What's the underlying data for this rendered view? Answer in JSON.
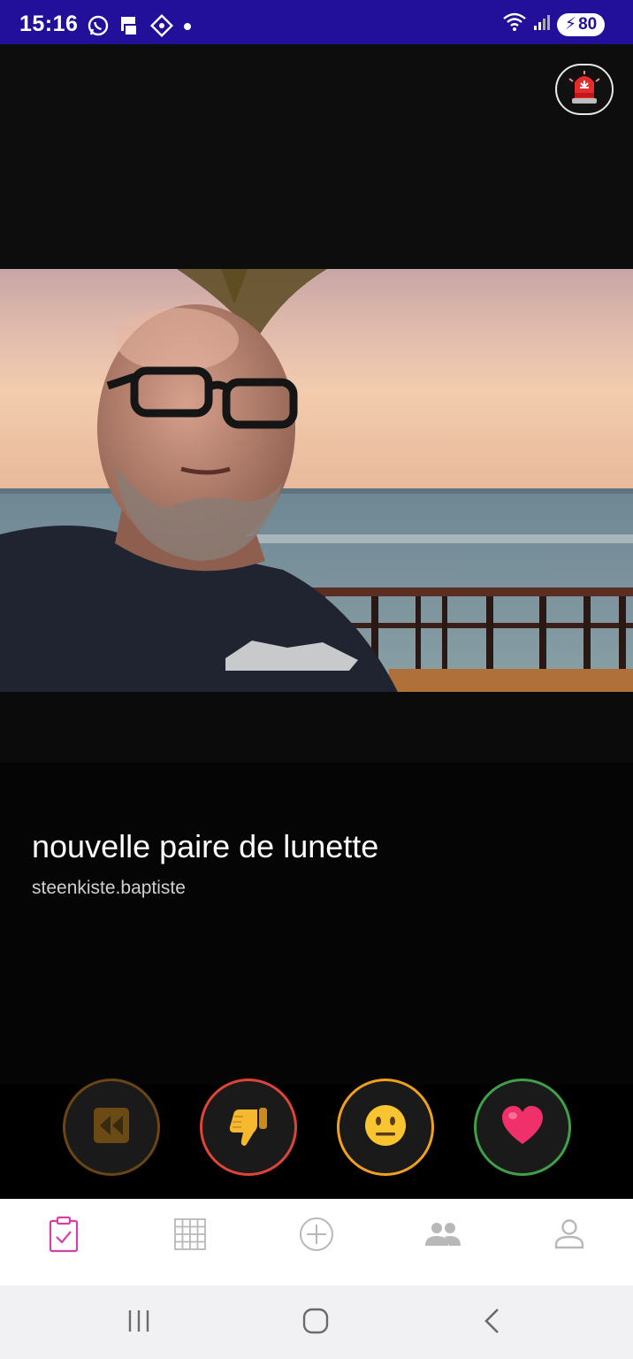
{
  "status_bar": {
    "time": "15:16",
    "battery": "80",
    "icons": [
      "whatsapp-icon",
      "sim-icon",
      "game-icon",
      "dot-icon",
      "wifi-icon",
      "signal-icon",
      "battery-icon"
    ]
  },
  "header": {
    "alarm_icon": "police-light-icon"
  },
  "post": {
    "title": "nouvelle paire de lunette",
    "username": "steenkiste.baptiste"
  },
  "actions": [
    {
      "name": "rewind",
      "icon": "rewind-icon",
      "color": "#6b4612"
    },
    {
      "name": "dislike",
      "icon": "thumbs-down-icon",
      "color": "#e04436"
    },
    {
      "name": "neutral",
      "icon": "neutral-face-icon",
      "color": "#f0a020"
    },
    {
      "name": "like",
      "icon": "heart-icon",
      "color": "#3fa048"
    }
  ],
  "bottom_nav": {
    "active_color": "#d63fa6",
    "items": [
      "feed-icon",
      "grid-icon",
      "add-icon",
      "group-icon",
      "profile-icon"
    ]
  },
  "system_nav": [
    "recents-icon",
    "home-icon",
    "back-icon"
  ]
}
